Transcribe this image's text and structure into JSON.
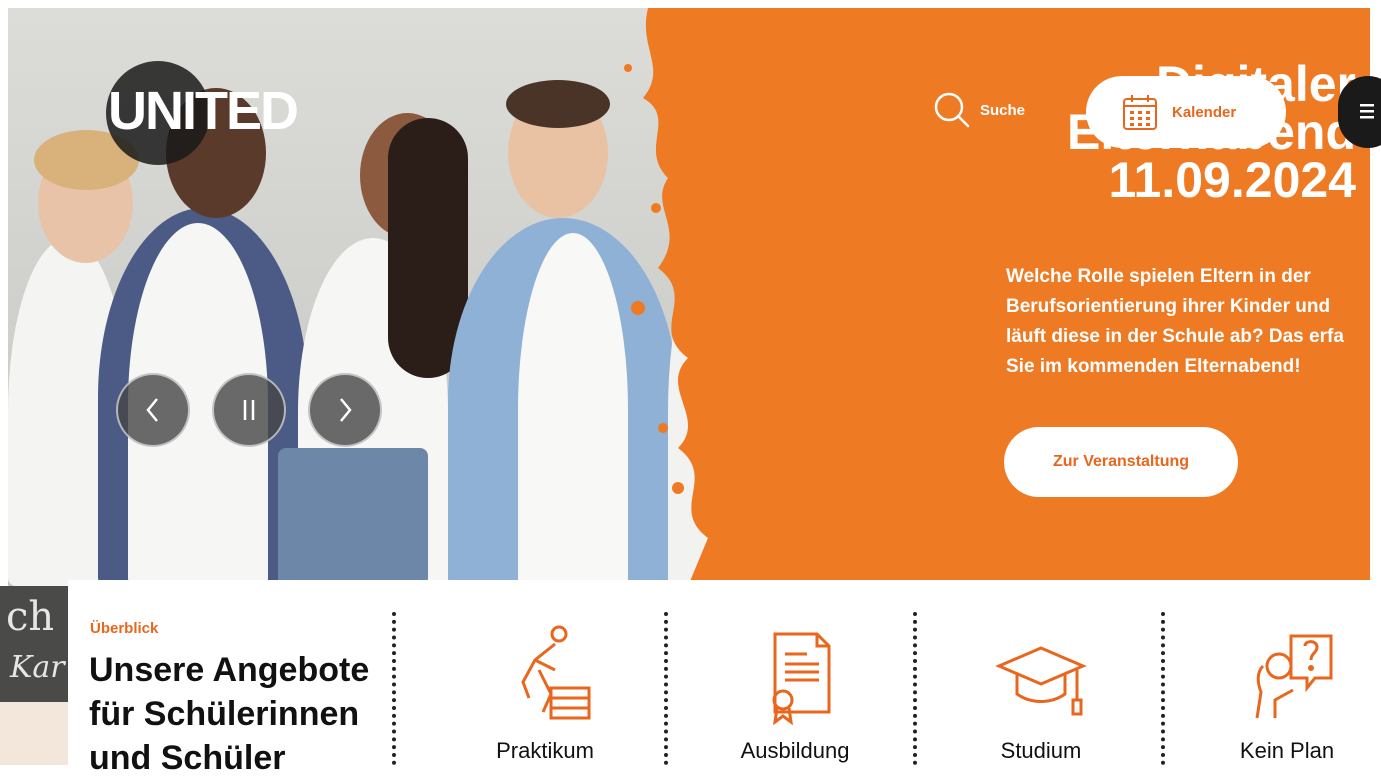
{
  "brand": {
    "logo_text": "UNITED"
  },
  "nav": {
    "search_label": "Suche",
    "calendar_label": "Kalender"
  },
  "hero": {
    "headline_line1": "Digitaler",
    "headline_line2": "Elternabend",
    "headline_date": "11.09.2024",
    "description_lines": [
      "Welche Rolle spielen Eltern in der",
      "Berufsorientierung ihrer Kinder und",
      "läuft diese in der Schule ab? Das erfa",
      "Sie im kommenden Elternabend!"
    ],
    "cta_label": "Zur Veranstaltung"
  },
  "overview": {
    "eyebrow": "Überblick",
    "title_lines": [
      "Unsere Angebote",
      "für Schülerinnen",
      "und Schüler"
    ],
    "offers": [
      {
        "label": "Praktikum",
        "icon": "bricklayer-icon"
      },
      {
        "label": "Ausbildung",
        "icon": "certificate-icon"
      },
      {
        "label": "Studium",
        "icon": "graduation-cap-icon"
      },
      {
        "label": "Kein Plan",
        "icon": "question-head-icon"
      }
    ]
  },
  "background_text": {
    "chalk_line1": "ch",
    "chalk_line2": "Kar"
  },
  "colors": {
    "accent": "#ef7a24",
    "accent_text": "#e9661d",
    "dark": "#1a1a1a"
  }
}
